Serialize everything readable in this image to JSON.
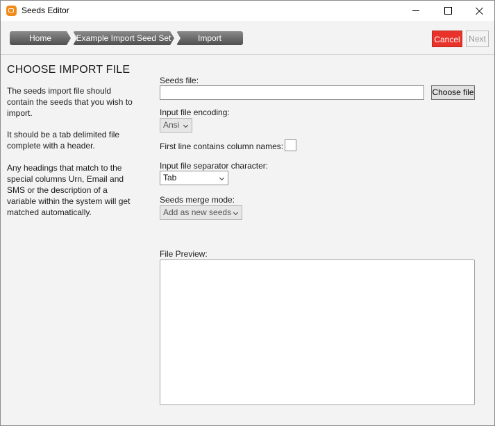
{
  "window": {
    "title": "Seeds Editor",
    "accent_color": "#f28b1a"
  },
  "breadcrumb": {
    "items": [
      {
        "label": "Home"
      },
      {
        "label": "Example Import Seed Set"
      },
      {
        "label": "Import"
      }
    ]
  },
  "toolbar": {
    "cancel_label": "Cancel",
    "next_label": "Next",
    "cancel_color": "#e8332b"
  },
  "left_panel": {
    "heading": "CHOOSE IMPORT FILE",
    "paragraphs": [
      "The seeds import file should contain the seeds that you wish to import.",
      "It should be a tab delimited file complete with a header.",
      "Any headings that match to the special columns Urn, Email and SMS or the description of a variable within the system will get matched automatically."
    ]
  },
  "form": {
    "seeds_file_label": "Seeds file:",
    "seeds_file_value": "",
    "choose_file_label": "Choose file",
    "encoding_label": "Input file encoding:",
    "encoding_value": "Ansi",
    "first_line_label": "First line contains column names:",
    "first_line_checked": false,
    "separator_label": "Input file separator character:",
    "separator_value": "Tab",
    "merge_label": "Seeds merge mode:",
    "merge_value": "Add as new seeds",
    "preview_label": "File Preview:"
  }
}
